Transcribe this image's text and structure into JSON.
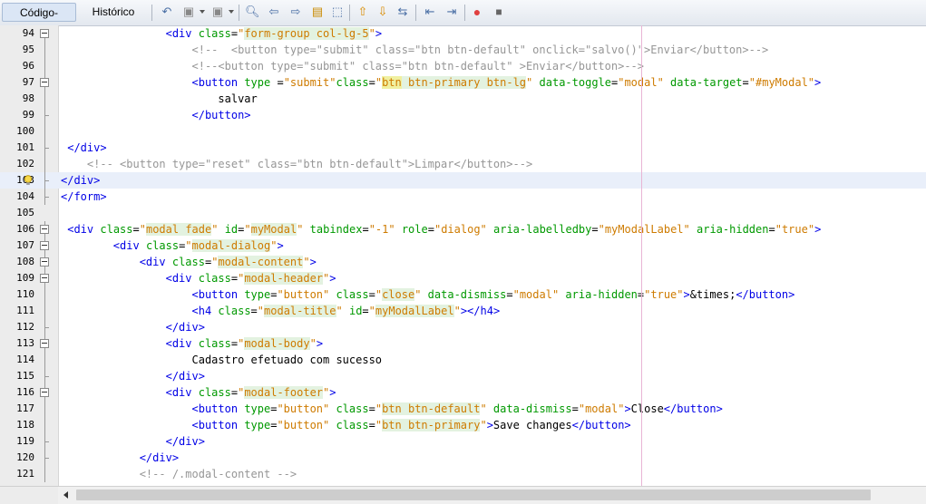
{
  "tabs": [
    {
      "label": "Código-Fonte",
      "active": true
    },
    {
      "label": "Histórico",
      "active": false
    }
  ],
  "toolbar_icons": [
    "last-edit-icon",
    "back-icon",
    "forward-icon",
    "find-selection-icon",
    "find-previous-icon",
    "find-next-icon",
    "toggle-highlight-icon",
    "toggle-rect-selection-icon",
    "previous-bookmark-icon",
    "next-bookmark-icon",
    "toggle-bookmark-icon",
    "shift-left-icon",
    "shift-right-icon",
    "start-macro-icon",
    "stop-macro-icon"
  ],
  "lines": [
    {
      "n": "94",
      "fold": "box",
      "html": "                <span class='t'>&lt;div</span> <span class='a'>class</span><span class='x'>=</span><span class='v'>\"<span class='m'>form-group col-lg-5</span>\"</span><span class='t'>&gt;</span>"
    },
    {
      "n": "95",
      "fold": "line",
      "html": "                    <span class='c'>&lt;!--  &lt;button type=\"submit\" class=\"btn btn-default\" onclick=\"salvo()\"&gt;Enviar&lt;/button&gt;--&gt;</span>"
    },
    {
      "n": "96",
      "fold": "line",
      "html": "                    <span class='c'>&lt;!--&lt;button type=\"submit\" class=\"btn btn-default\" &gt;Enviar&lt;/button&gt;--&gt;</span>"
    },
    {
      "n": "97",
      "fold": "box",
      "html": "                    <span class='t'>&lt;button</span> <span class='a'>type</span> <span class='x'>=</span><span class='v'>\"submit\"</span><span class='a'>class</span><span class='x'>=</span><span class='v'>\"<span class='m2'>btn</span><span class='m'> btn-primary btn-lg</span>\"</span> <span class='a'>data-toggle</span><span class='x'>=</span><span class='v'>\"modal\"</span> <span class='a'>data-target</span><span class='x'>=</span><span class='v'>\"#myModal\"</span><span class='t'>&gt;</span>"
    },
    {
      "n": "98",
      "fold": "line",
      "html": "                        <span class='x'>salvar</span>"
    },
    {
      "n": "99",
      "fold": "end",
      "html": "                    <span class='t'>&lt;/button&gt;</span>"
    },
    {
      "n": "100",
      "fold": "line",
      "html": ""
    },
    {
      "n": "101",
      "fold": "end",
      "html": " <span class='t'>&lt;/div&gt;</span>"
    },
    {
      "n": "102",
      "fold": "line",
      "html": "    <span class='c'>&lt;!-- &lt;button type=\"reset\" class=\"btn btn-default\"&gt;Limpar&lt;/button&gt;--&gt;</span>"
    },
    {
      "n": "103",
      "fold": "end",
      "hint": true,
      "hl": true,
      "html": "<span class='t'>&lt;/div&gt;</span>"
    },
    {
      "n": "104",
      "fold": "end",
      "html": "<span class='t'>&lt;/form&gt;</span>"
    },
    {
      "n": "105",
      "fold": "none",
      "html": ""
    },
    {
      "n": "106",
      "fold": "box",
      "html": " <span class='t'>&lt;div</span> <span class='a'>class</span><span class='x'>=</span><span class='v'>\"<span class='m'>modal fade</span>\"</span> <span class='a'>id</span><span class='x'>=</span><span class='v'>\"<span class='m'>myModal</span>\"</span> <span class='a'>tabindex</span><span class='x'>=</span><span class='v'>\"-1\"</span> <span class='a'>role</span><span class='x'>=</span><span class='v'>\"dialog\"</span> <span class='a'>aria-labelledby</span><span class='x'>=</span><span class='v'>\"myModalLabel\"</span> <span class='a'>aria-hidden</span><span class='x'>=</span><span class='v'>\"true\"</span><span class='t'>&gt;</span>"
    },
    {
      "n": "107",
      "fold": "box",
      "html": "        <span class='t'>&lt;div</span> <span class='a'>class</span><span class='x'>=</span><span class='v'>\"<span class='m'>modal-dialog</span>\"</span><span class='t'>&gt;</span>"
    },
    {
      "n": "108",
      "fold": "box",
      "html": "            <span class='t'>&lt;div</span> <span class='a'>class</span><span class='x'>=</span><span class='v'>\"<span class='m'>modal-content</span>\"</span><span class='t'>&gt;</span>"
    },
    {
      "n": "109",
      "fold": "box",
      "html": "                <span class='t'>&lt;div</span> <span class='a'>class</span><span class='x'>=</span><span class='v'>\"<span class='m'>modal-header</span>\"</span><span class='t'>&gt;</span>"
    },
    {
      "n": "110",
      "fold": "line",
      "html": "                    <span class='t'>&lt;button</span> <span class='a'>type</span><span class='x'>=</span><span class='v'>\"button\"</span> <span class='a'>class</span><span class='x'>=</span><span class='v'>\"<span class='m'>close</span>\"</span> <span class='a'>data-dismiss</span><span class='x'>=</span><span class='v'>\"modal\"</span> <span class='a'>aria-hidden</span><span class='x'>=</span><span class='v'>\"true\"</span><span class='t'>&gt;</span><span class='x'>&amp;times;</span><span class='t'>&lt;/button&gt;</span>"
    },
    {
      "n": "111",
      "fold": "line",
      "html": "                    <span class='t'>&lt;h4</span> <span class='a'>class</span><span class='x'>=</span><span class='v'>\"<span class='m'>modal-title</span>\"</span> <span class='a'>id</span><span class='x'>=</span><span class='v'>\"<span class='m'>myModalLabel</span>\"</span><span class='t'>&gt;&lt;/h4&gt;</span>"
    },
    {
      "n": "112",
      "fold": "end",
      "html": "                <span class='t'>&lt;/div&gt;</span>"
    },
    {
      "n": "113",
      "fold": "box",
      "html": "                <span class='t'>&lt;div</span> <span class='a'>class</span><span class='x'>=</span><span class='v'>\"<span class='m'>modal-body</span>\"</span><span class='t'>&gt;</span>"
    },
    {
      "n": "114",
      "fold": "line",
      "html": "                    <span class='x'>Cadastro efetuado com sucesso</span>"
    },
    {
      "n": "115",
      "fold": "end",
      "html": "                <span class='t'>&lt;/div&gt;</span>"
    },
    {
      "n": "116",
      "fold": "box",
      "html": "                <span class='t'>&lt;div</span> <span class='a'>class</span><span class='x'>=</span><span class='v'>\"<span class='m'>modal-footer</span>\"</span><span class='t'>&gt;</span>"
    },
    {
      "n": "117",
      "fold": "line",
      "html": "                    <span class='t'>&lt;button</span> <span class='a'>type</span><span class='x'>=</span><span class='v'>\"button\"</span> <span class='a'>class</span><span class='x'>=</span><span class='v'>\"<span class='m'>btn btn-default</span>\"</span> <span class='a'>data-dismiss</span><span class='x'>=</span><span class='v'>\"modal\"</span><span class='t'>&gt;</span><span class='x'>Close</span><span class='t'>&lt;/button&gt;</span>"
    },
    {
      "n": "118",
      "fold": "line",
      "html": "                    <span class='t'>&lt;button</span> <span class='a'>type</span><span class='x'>=</span><span class='v'>\"button\"</span> <span class='a'>class</span><span class='x'>=</span><span class='v'>\"<span class='m'>btn btn-primary</span>\"</span><span class='t'>&gt;</span><span class='x'>Save changes</span><span class='t'>&lt;/button&gt;</span>"
    },
    {
      "n": "119",
      "fold": "end",
      "html": "                <span class='t'>&lt;/div&gt;</span>"
    },
    {
      "n": "120",
      "fold": "end",
      "html": "            <span class='t'>&lt;/div&gt;</span>"
    },
    {
      "n": "121",
      "fold": "line",
      "html": "            <span class='c'>&lt;!-- /.modal-content --&gt;</span>"
    }
  ]
}
